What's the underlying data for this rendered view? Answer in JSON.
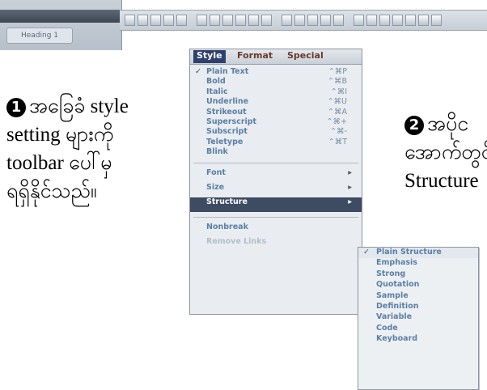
{
  "window_fragment": {
    "tab_label": "Heading 1"
  },
  "notes": [
    {
      "number": "1",
      "text_lines": [
        "အခြေခံ style",
        "setting များကို",
        "toolbar ပေါ်မှ",
        "ရရှိနိုင်သည်။"
      ]
    },
    {
      "number": "2",
      "text_lines": [
        "အပိုင",
        "အောက်တွင်",
        "Structure"
      ]
    }
  ],
  "menu": {
    "tabs": [
      "Style",
      "Format",
      "Special"
    ],
    "active_tab": "Style",
    "style_items": [
      {
        "label": "Plain Text",
        "shortcut": "⌃⌘P",
        "checked": true
      },
      {
        "label": "Bold",
        "shortcut": "⌃⌘B",
        "checked": false
      },
      {
        "label": "Italic",
        "shortcut": "⌃⌘I",
        "checked": false
      },
      {
        "label": "Underline",
        "shortcut": "⌃⌘U",
        "checked": false
      },
      {
        "label": "Strikeout",
        "shortcut": "⌃⌘A",
        "checked": false
      },
      {
        "label": "Superscript",
        "shortcut": "⌃⌘+",
        "checked": false
      },
      {
        "label": "Subscript",
        "shortcut": "⌃⌘-",
        "checked": false
      },
      {
        "label": "Teletype",
        "shortcut": "⌃⌘T",
        "checked": false
      },
      {
        "label": "Blink",
        "shortcut": "",
        "checked": false
      }
    ],
    "sub_items": [
      {
        "label": "Font",
        "state": "normal"
      },
      {
        "label": "Size",
        "state": "normal"
      },
      {
        "label": "Structure",
        "state": "active"
      }
    ],
    "other_items": [
      {
        "label": "Nonbreak",
        "state": "normal"
      },
      {
        "label": "Remove Links",
        "state": "disabled"
      }
    ]
  },
  "submenu": {
    "items": [
      {
        "label": "Plain Structure",
        "checked": true
      },
      {
        "label": "Emphasis",
        "checked": false
      },
      {
        "label": "Strong",
        "checked": false
      },
      {
        "label": "Quotation",
        "checked": false
      },
      {
        "label": "Sample",
        "checked": false
      },
      {
        "label": "Definition",
        "checked": false
      },
      {
        "label": "Variable",
        "checked": false
      },
      {
        "label": "Code",
        "checked": false
      },
      {
        "label": "Keyboard",
        "checked": false
      }
    ]
  },
  "colors": {
    "menu_text": "#5a7fa6",
    "active_row_bg": "#3d4b63",
    "active_tab_bg": "#2f3f6e"
  }
}
